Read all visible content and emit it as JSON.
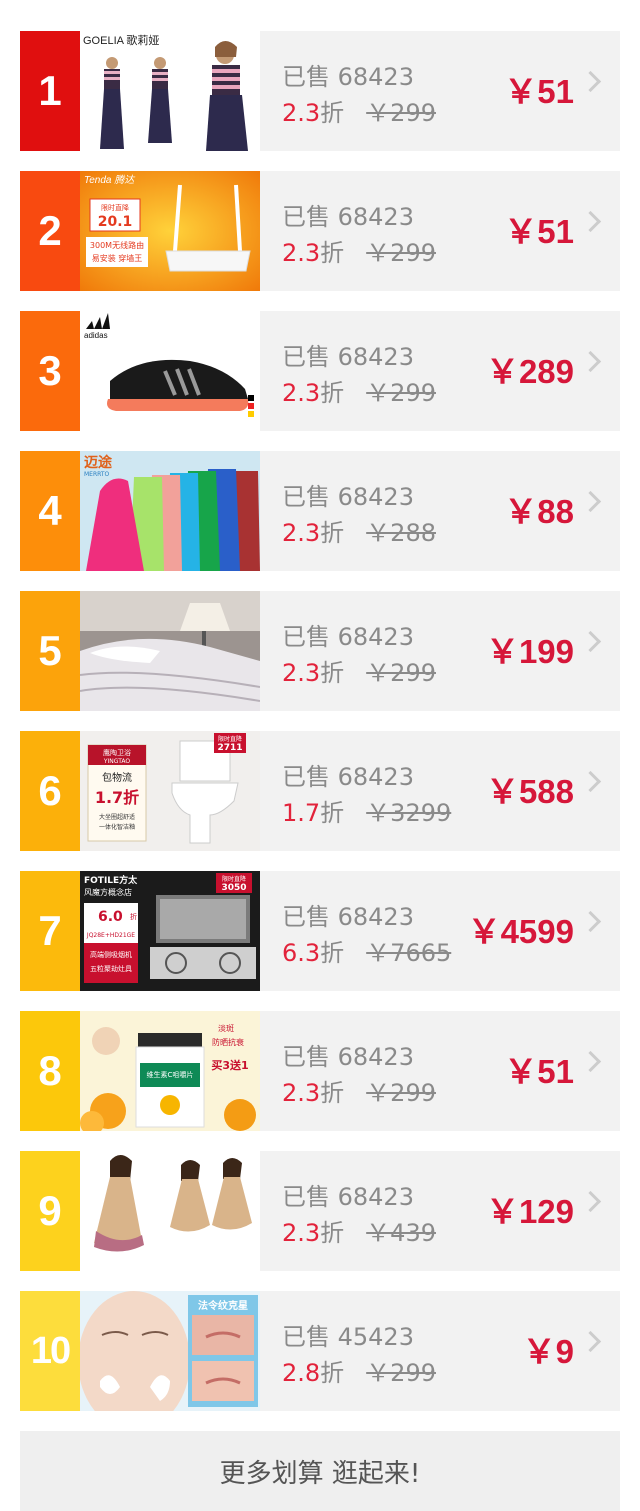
{
  "colors": {
    "price": "#d6173a",
    "discount": "#e2233b",
    "rank_colors": [
      "#e00f0f",
      "#f84a10",
      "#fb6a0c",
      "#fd8e0a",
      "#fca30b",
      "#fcb00a",
      "#fcba0c",
      "#fcc80b",
      "#fdd21d",
      "#fddd3c"
    ]
  },
  "items": [
    {
      "rank": "1",
      "image": "dress-models-photo",
      "brand": "GOELIA 歌莉娅",
      "sold": "已售 68423",
      "discount": "2.3",
      "zhe": "折",
      "original": "￥299",
      "price": "￥51"
    },
    {
      "rank": "2",
      "image": "wifi-router-photo",
      "brand": "Tenda 腾达",
      "badge": "限时直降 20.1",
      "caption": "300M无线路由 易安装 穿墙王",
      "sold": "已售 68423",
      "discount": "2.3",
      "zhe": "折",
      "original": "￥299",
      "price": "￥51"
    },
    {
      "rank": "3",
      "image": "sneaker-photo",
      "brand": "adidas",
      "sold": "已售 68423",
      "discount": "2.3",
      "zhe": "折",
      "original": "￥299",
      "price": "￥289"
    },
    {
      "rank": "4",
      "image": "jackets-photo",
      "brand": "迈途 MERRTO",
      "sold": "已售 68423",
      "discount": "2.3",
      "zhe": "折",
      "original": "￥288",
      "price": "￥88"
    },
    {
      "rank": "5",
      "image": "bedding-photo",
      "brand": "",
      "sold": "已售 68423",
      "discount": "2.3",
      "zhe": "折",
      "original": "￥299",
      "price": "￥199"
    },
    {
      "rank": "6",
      "image": "toilet-photo",
      "brand": "鹰陶卫浴 YINGTAO",
      "badge": "限时直降 2711",
      "caption": "包物流 1.7折 大坐圈超舒适 一体化智洁釉",
      "sold": "已售 68423",
      "discount": "1.7",
      "zhe": "折",
      "original": "￥3299",
      "price": "￥588"
    },
    {
      "rank": "7",
      "image": "range-hood-photo",
      "brand": "FOTILE方太 风魔方概念店",
      "badge": "限时直降 3050",
      "caption": "6.0折 JQ28E+HD21GE 高端侧吸烟机 五粒聚劫灶具",
      "sold": "已售 68423",
      "discount": "6.3",
      "zhe": "折",
      "original": "￥7665",
      "price": "￥4599"
    },
    {
      "rank": "8",
      "image": "vitamin-c-photo",
      "brand": "",
      "caption": "淡斑 防晒抗衰 买3送1 维生素C咀嚼片",
      "sold": "已售 68423",
      "discount": "2.3",
      "zhe": "折",
      "original": "￥299",
      "price": "￥51"
    },
    {
      "rank": "9",
      "image": "lace-dress-photo",
      "brand": "",
      "sold": "已售 68423",
      "discount": "2.3",
      "zhe": "折",
      "original": "￥439",
      "price": "￥129"
    },
    {
      "rank": "10",
      "image": "face-care-photo",
      "brand": "法令纹克星",
      "sold": "已售 45423",
      "discount": "2.8",
      "zhe": "折",
      "original": "￥299",
      "price": "￥9"
    }
  ],
  "footer": {
    "more_label": "更多划算  逛起来!"
  }
}
